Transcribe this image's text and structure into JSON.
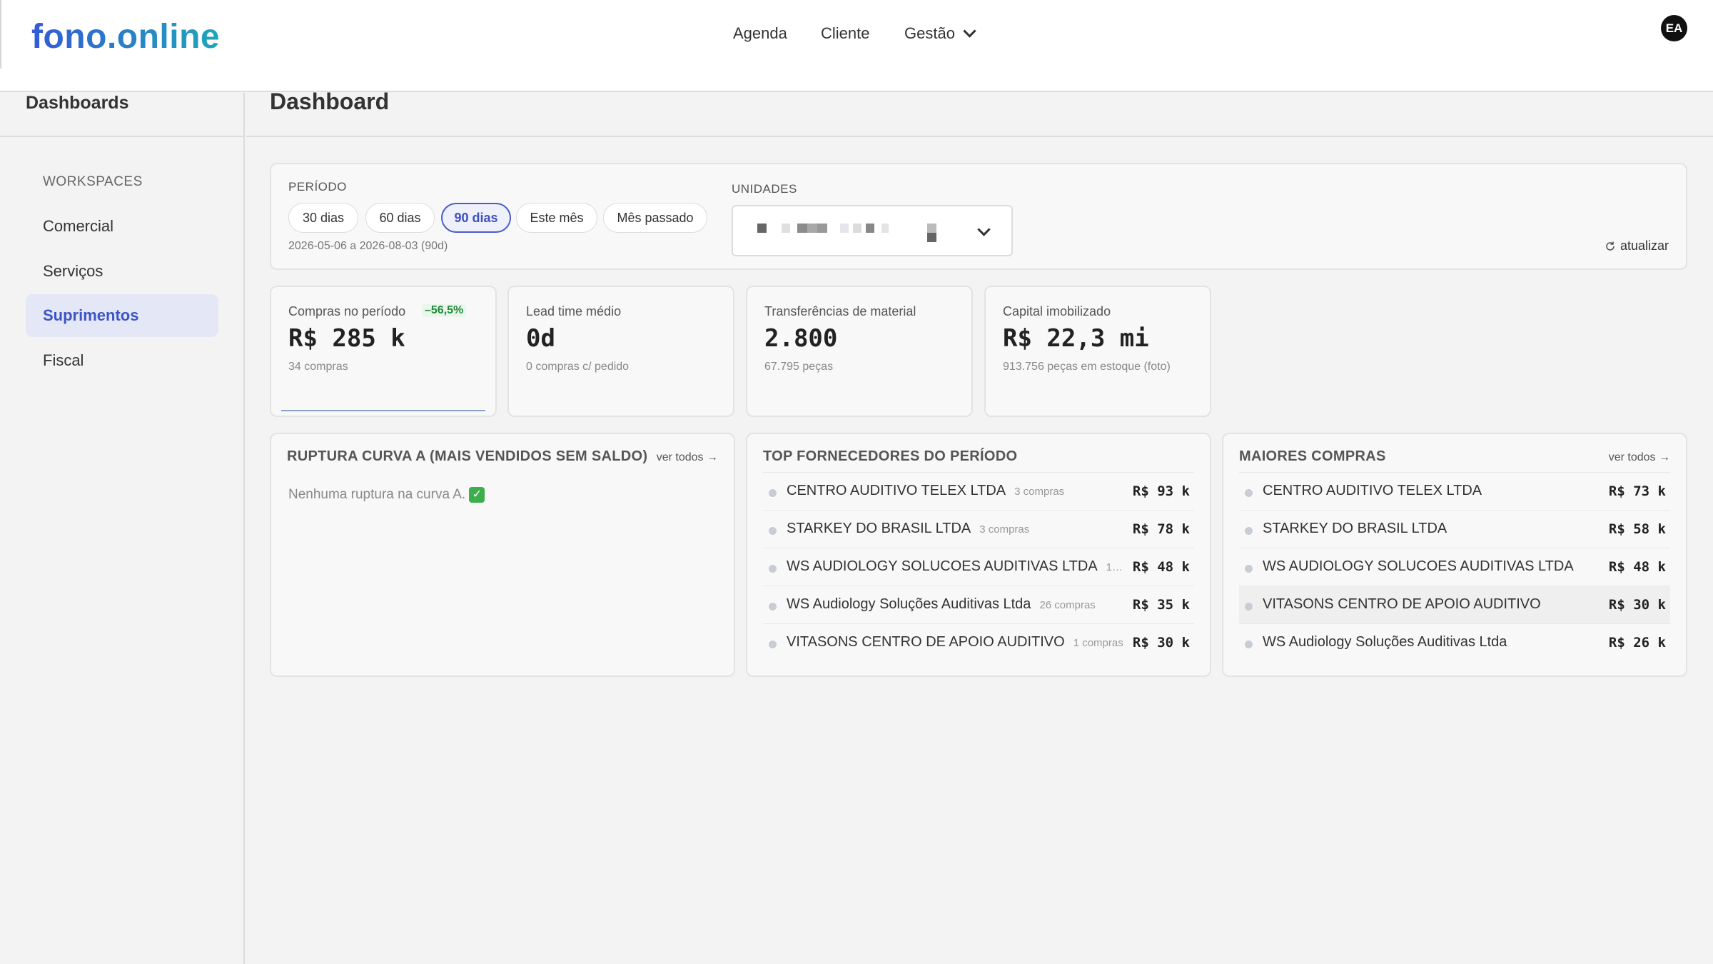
{
  "app": {
    "logo": "fono.online",
    "avatar_initials": "EA"
  },
  "nav": {
    "agenda": "Agenda",
    "cliente": "Cliente",
    "gestao": "Gestão"
  },
  "sidebar": {
    "title": "Dashboards",
    "section_label": "WORKSPACES",
    "items": [
      {
        "label": "Comercial",
        "active": false
      },
      {
        "label": "Serviços",
        "active": false
      },
      {
        "label": "Suprimentos",
        "active": true
      },
      {
        "label": "Fiscal",
        "active": false
      }
    ]
  },
  "main": {
    "title": "Dashboard"
  },
  "filters": {
    "period_label": "PERÍODO",
    "period_options": [
      "30 dias",
      "60 dias",
      "90 dias",
      "Este mês",
      "Mês passado"
    ],
    "period_selected": "90 dias",
    "range_text": "2026-05-06 a 2026-08-03 (90d)",
    "units_label": "UNIDADES",
    "refresh_label": "atualizar"
  },
  "kpis": [
    {
      "label": "Compras no período",
      "badge": "–56,5%",
      "value": "R$ 285 k",
      "sub": "34 compras"
    },
    {
      "label": "Lead time médio",
      "value": "0d",
      "sub": "0 compras c/ pedido"
    },
    {
      "label": "Transferências de material",
      "value": "2.800",
      "sub": "67.795 peças"
    },
    {
      "label": "Capital imobilizado",
      "value": "R$ 22,3 mi",
      "sub": "913.756 peças em estoque (foto)"
    }
  ],
  "ruptura": {
    "title": "RUPTURA CURVA A (MAIS VENDIDOS SEM SALDO)",
    "link": "ver todos →",
    "empty_message": "Nenhuma ruptura na curva A."
  },
  "top_fornecedores": {
    "title": "TOP FORNECEDORES DO PERÍODO",
    "rows": [
      {
        "name": "CENTRO AUDITIVO TELEX LTDA",
        "meta": "3 compras",
        "amount": "R$ 93 k"
      },
      {
        "name": "STARKEY DO BRASIL LTDA",
        "meta": "3 compras",
        "amount": "R$ 78 k"
      },
      {
        "name": "WS AUDIOLOGY SOLUCOES AUDITIVAS LTDA",
        "meta": "1…",
        "amount": "R$ 48 k"
      },
      {
        "name": "WS Audiology Soluções Auditivas Ltda",
        "meta": "26 compras",
        "amount": "R$ 35 k"
      },
      {
        "name": "VITASONS CENTRO DE APOIO AUDITIVO",
        "meta": "1 compras",
        "amount": "R$ 30 k"
      }
    ]
  },
  "maiores_compras": {
    "title": "MAIORES COMPRAS",
    "link": "ver todos →",
    "rows": [
      {
        "name": "CENTRO AUDITIVO TELEX LTDA",
        "amount": "R$ 73 k"
      },
      {
        "name": "STARKEY DO BRASIL LTDA",
        "amount": "R$ 58 k"
      },
      {
        "name": "WS AUDIOLOGY SOLUCOES AUDITIVAS LTDA",
        "amount": "R$ 48 k"
      },
      {
        "name": "VITASONS CENTRO DE APOIO AUDITIVO",
        "amount": "R$ 30 k"
      },
      {
        "name": "WS Audiology Soluções Auditivas Ltda",
        "amount": "R$ 26 k"
      }
    ]
  }
}
